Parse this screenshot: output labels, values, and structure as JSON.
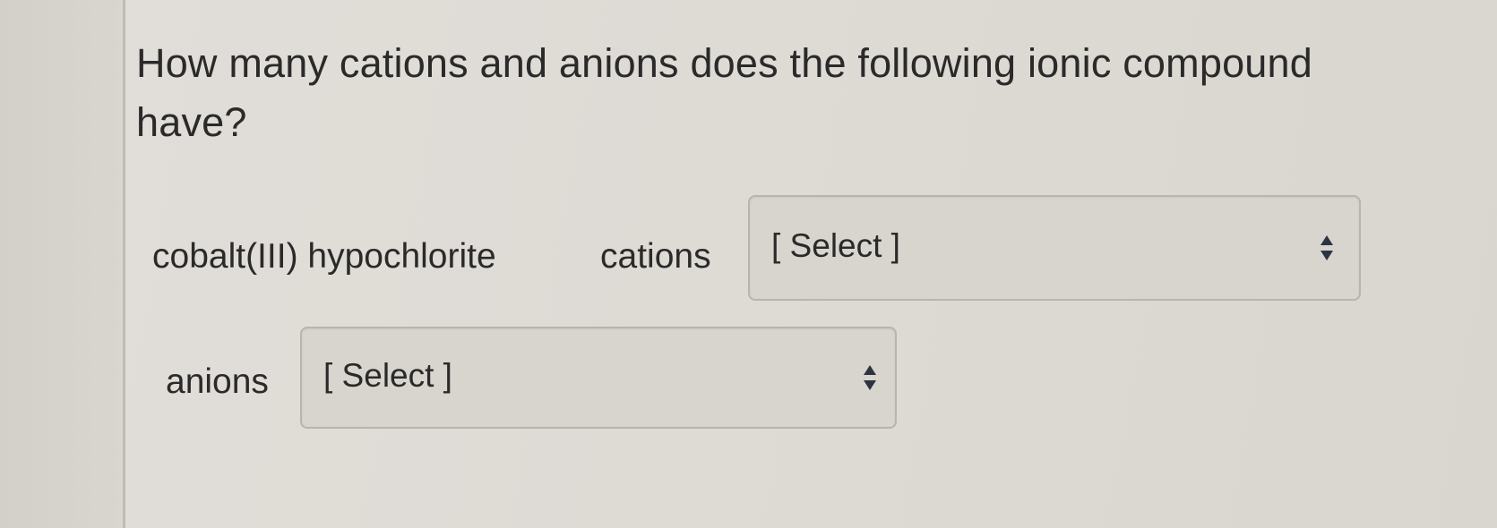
{
  "question": {
    "text": "How many cations and anions does the following ionic compound have?"
  },
  "compound": {
    "name": "cobalt(III) hypochlorite"
  },
  "cations": {
    "label": "cations",
    "selected": "[ Select ]"
  },
  "anions": {
    "label": "anions",
    "selected": "[ Select ]"
  },
  "icons": {
    "dropdown": "up-down-arrows-icon"
  }
}
